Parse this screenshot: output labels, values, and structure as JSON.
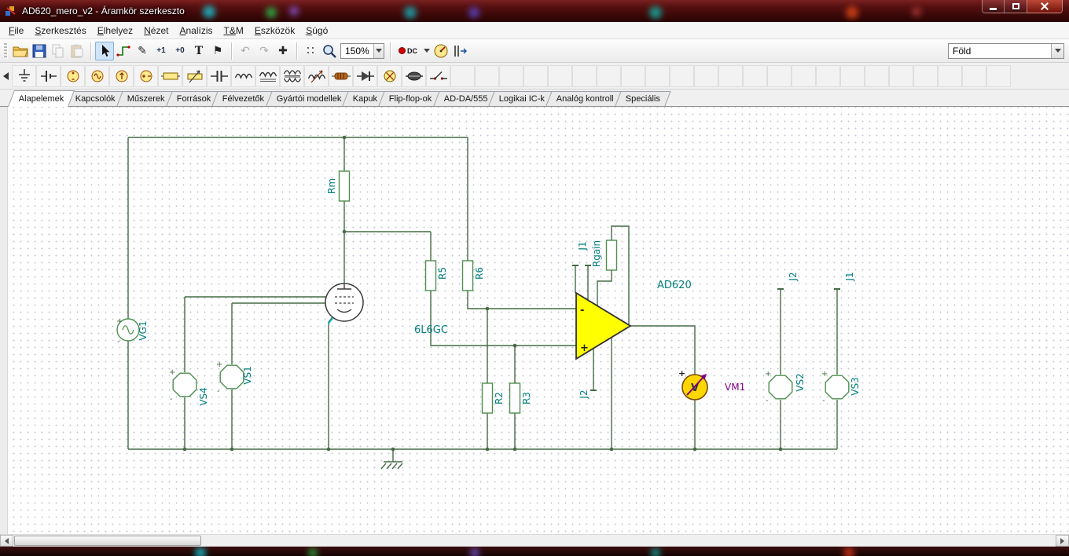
{
  "window": {
    "title": "AD620_mero_v2 - Áramkör szerkeszto"
  },
  "menu": {
    "items": [
      "File",
      "Szerkesztés",
      "Elhelyez",
      "Nézet",
      "Analízis",
      "T&M",
      "Eszközök",
      "Súgó"
    ]
  },
  "toolbar": {
    "zoom_value": "150%",
    "dc_label": "DC",
    "text_tool": "T",
    "logic_high": "+1",
    "logic_low": "+0",
    "pen_glyph": "✎",
    "flag_glyph": "⚑",
    "undo_glyph": "↶",
    "redo_glyph": "↷",
    "move_glyph": "✚",
    "ground_combo_value": "Föld",
    "icon_names": [
      "open",
      "save",
      "copy",
      "paste",
      "select-cursor",
      "wire",
      "pen",
      "logic-high",
      "logic-low",
      "text",
      "flag",
      "undo",
      "redo",
      "move",
      "grid",
      "zoom",
      "zoom-level",
      "dc-analysis",
      "meter",
      "instrument-probe",
      "ground-node"
    ]
  },
  "component_bar": {
    "icon_names": [
      "ground",
      "battery",
      "voltage-source",
      "voltage-generator",
      "current-source",
      "current-generator",
      "resistor",
      "potentiometer",
      "capacitor",
      "inductor",
      "iron-core-inductor",
      "transformer",
      "coupled-inductors",
      "resistor-us",
      "diode",
      "lamp",
      "fuse",
      "switch"
    ]
  },
  "tabs": {
    "selected": "Alapelemek",
    "items": [
      "Alapelemek",
      "Kapcsolók",
      "Műszerek",
      "Források",
      "Félvezetők",
      "Gyártói modellek",
      "Kapuk",
      "Flip-flop-ok",
      "AD-DA/555",
      "Logikai IC-k",
      "Analóg kontroll",
      "Speciális"
    ]
  },
  "schematic": {
    "labels": {
      "rm": "Rm",
      "vg1": "VG1",
      "vs4": "VS4",
      "vs1": "VS1",
      "tube": "6L6GC",
      "r5": "R5",
      "r6": "R6",
      "r2": "R2",
      "r3": "R3",
      "j1_top": "J1",
      "rgain": "Rgain",
      "ad620": "AD620",
      "j2_bottom": "J2",
      "vm1": "VM1",
      "j2_right": "J2",
      "j1_right": "J1",
      "vs2": "VS2",
      "vs3": "VS3"
    },
    "marks": {
      "plus": "+",
      "minus": "-",
      "volt": "V"
    },
    "colors": {
      "wire": "#456b45",
      "component_outline": "#4e8f4e",
      "label": "#007d7d",
      "vm1_label": "#800080",
      "opamp_fill": "#ffff00",
      "meter_fill": "#ffd700",
      "selected_wire": "#00b8c8"
    }
  }
}
